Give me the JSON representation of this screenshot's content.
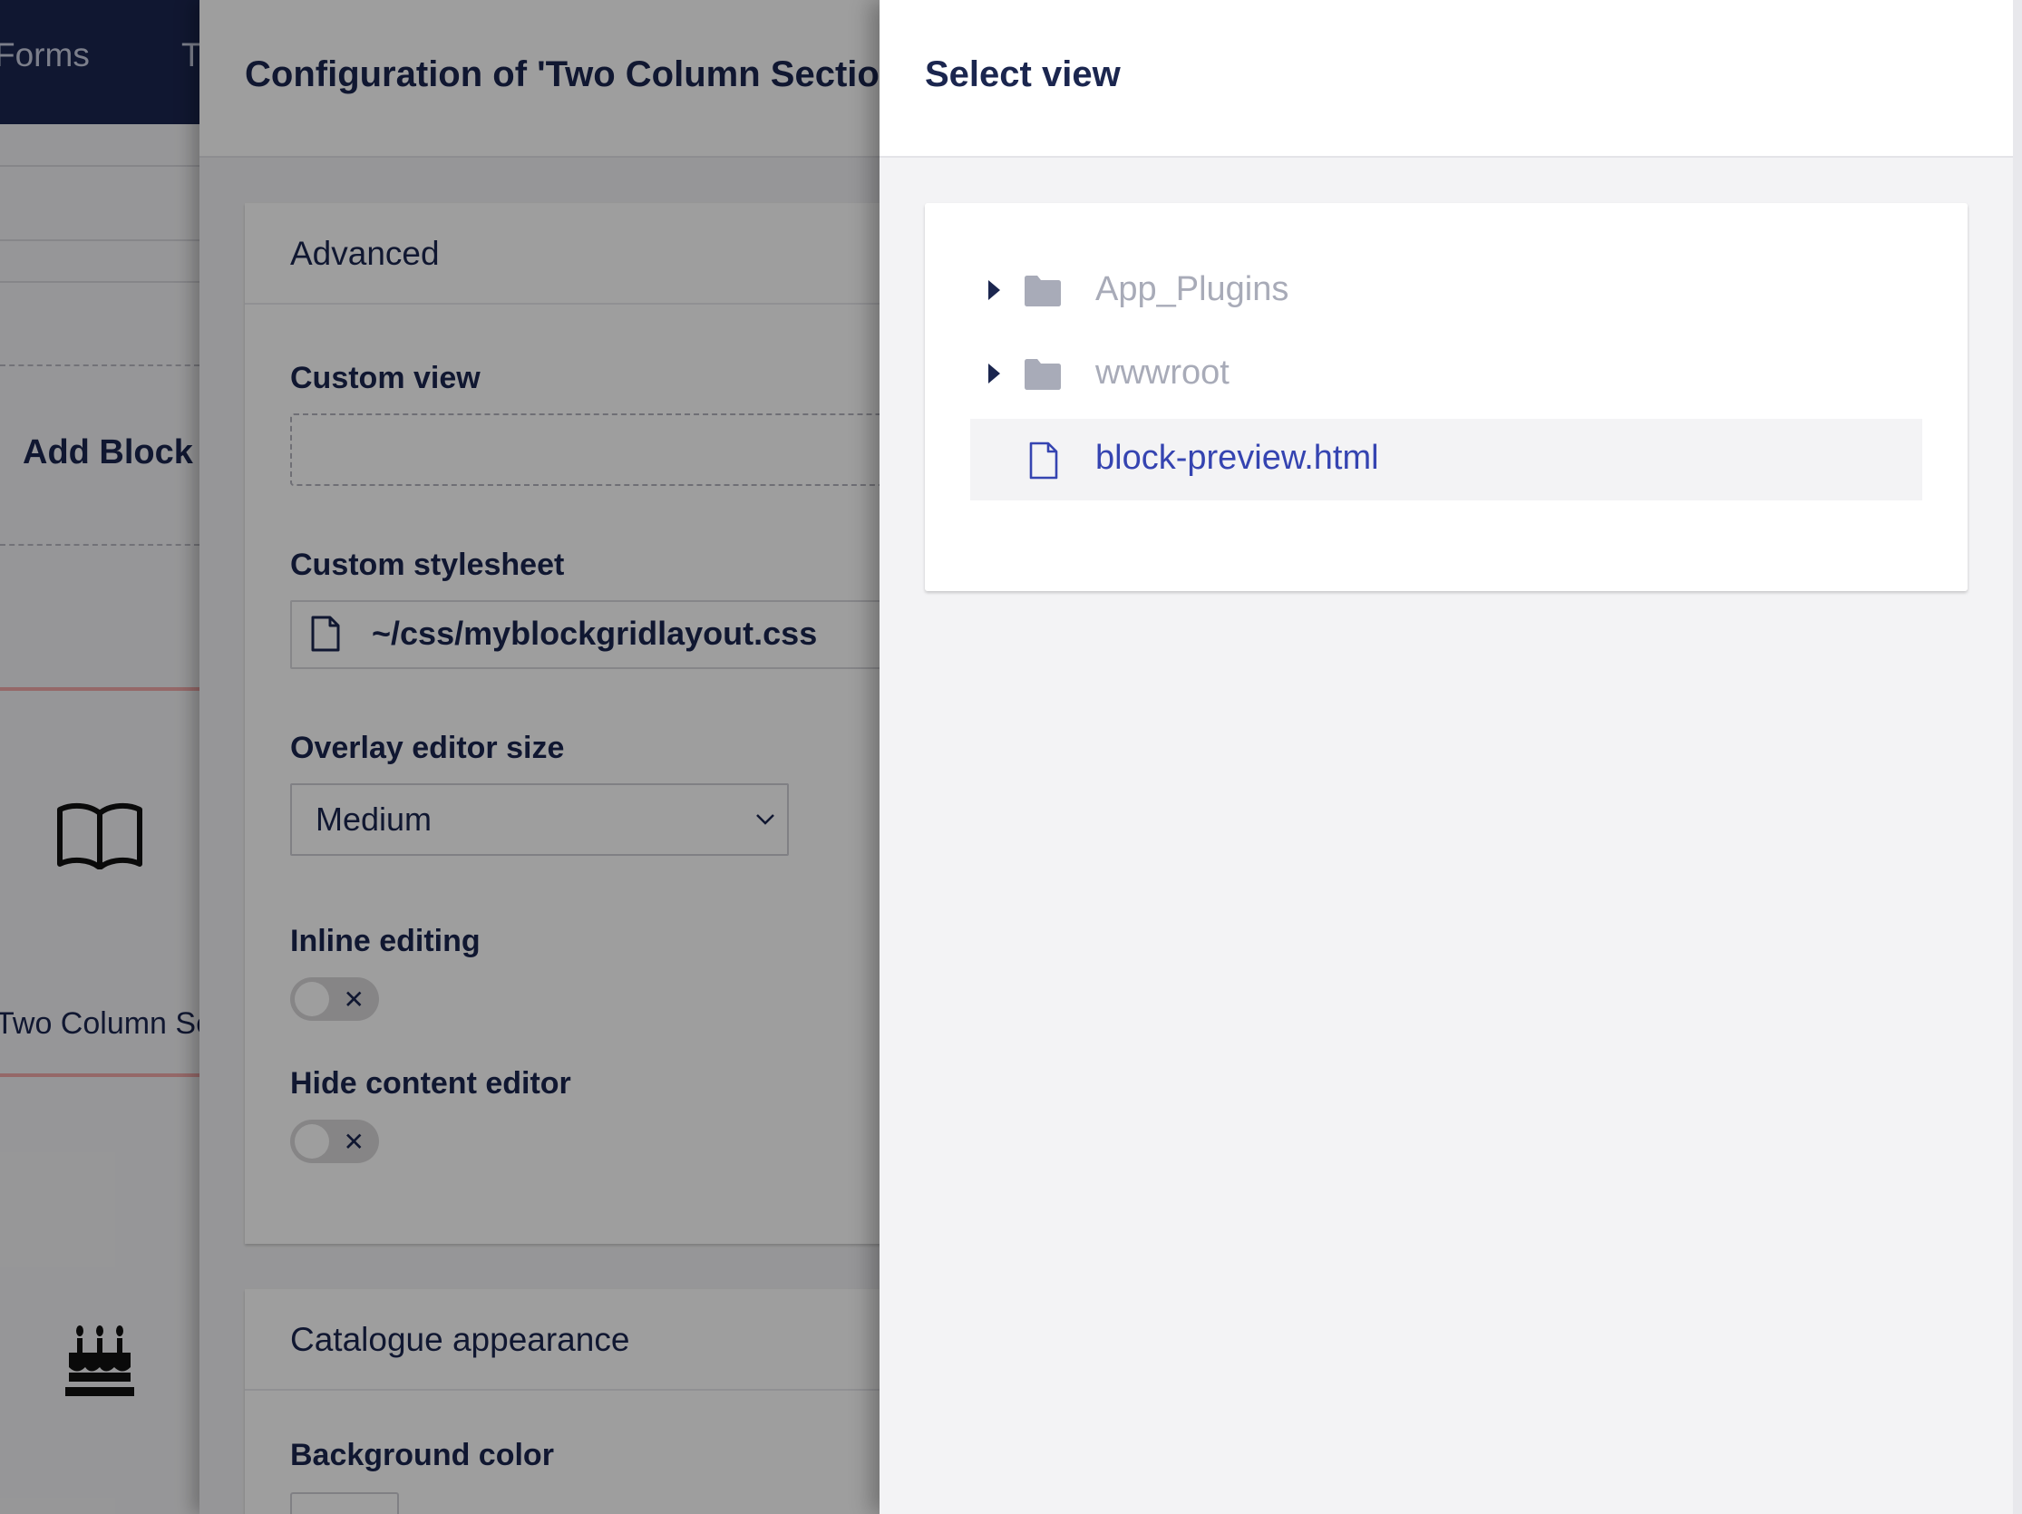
{
  "background_app": {
    "nav_items": [
      "Forms",
      "T"
    ],
    "add_block_label": "Add Block",
    "block_label": "Two Column Section",
    "block_icon": "book-icon",
    "second_block_icon": "birthday-cake-icon"
  },
  "config_panel": {
    "title": "Configuration of 'Two Column Section'",
    "advanced_group": {
      "heading": "Advanced",
      "custom_view_label": "Custom view",
      "custom_view_value": "",
      "custom_stylesheet_label": "Custom stylesheet",
      "custom_stylesheet_value": "~/css/myblockgridlayout.css",
      "overlay_size_label": "Overlay editor size",
      "overlay_size_value": "Medium",
      "inline_editing_label": "Inline editing",
      "inline_editing_enabled": false,
      "hide_content_editor_label": "Hide content editor",
      "hide_content_editor_enabled": false,
      "toggle_off_glyph": "✕"
    },
    "catalogue_group": {
      "heading": "Catalogue appearance",
      "background_color_label": "Background color"
    }
  },
  "select_view": {
    "title": "Select view",
    "tree": [
      {
        "label": "App_Plugins",
        "type": "folder",
        "expandable": true,
        "selectable": false
      },
      {
        "label": "wwwroot",
        "type": "folder",
        "expandable": true,
        "selectable": false
      },
      {
        "label": "block-preview.html",
        "type": "file",
        "expandable": false,
        "selectable": true
      }
    ]
  },
  "colors": {
    "navy": "#1b264f",
    "link_blue": "#3544b1",
    "disabled_grey": "#a8abb8",
    "block_border_pink": "#f0a9a9"
  }
}
